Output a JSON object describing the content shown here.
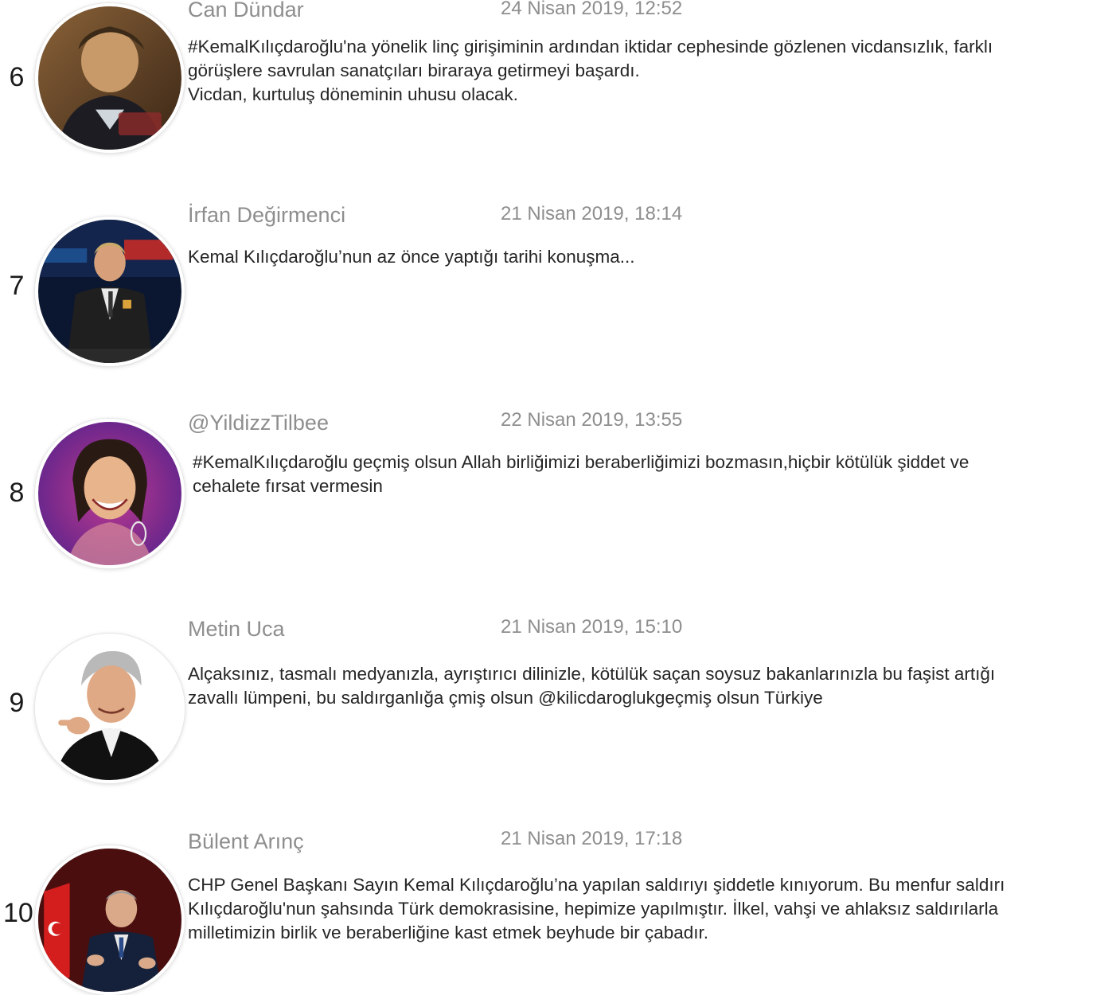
{
  "entries": [
    {
      "rank": "6",
      "name": "Can Dündar",
      "date": "24 Nisan 2019, 12:52",
      "avatar_icon": "person-photo-icon",
      "avatar_colors": [
        "#6b4a2a",
        "#1c1c22",
        "#d9b48a"
      ],
      "lines": [
        "#KemalKılıçdaroğlu'na yönelik linç girişiminin ardından iktidar cephesinde gözlenen vicdansızlık, farklı",
        "görüşlere savrulan sanatçıları biraraya getirmeyi başardı.",
        "Vicdan, kurtuluş döneminin uhusu olacak."
      ]
    },
    {
      "rank": "7",
      "name": "İrfan Değirmenci",
      "date": "21 Nisan 2019, 18:14",
      "avatar_icon": "person-photo-icon",
      "avatar_colors": [
        "#0b1730",
        "#1f1f1f",
        "#b22a2a"
      ],
      "lines": [
        "Kemal Kılıçdaroğlu’nun az önce yaptığı tarihi konuşma..."
      ]
    },
    {
      "rank": "8",
      "name": "@YildizzTilbee",
      "date": "22 Nisan 2019, 13:55",
      "avatar_icon": "person-photo-icon",
      "avatar_colors": [
        "#6a2fb0",
        "#c03a8f",
        "#e8b48c"
      ],
      "lines": [
        " #KemalKılıçdaroğlu geçmiş olsun  Allah birliğimizi beraberliğimizi bozmasın,hiçbir kötülük şiddet ve",
        " cehalete fırsat vermesin"
      ]
    },
    {
      "rank": "9",
      "name": "Metin Uca",
      "date": "21 Nisan 2019, 15:10",
      "avatar_icon": "person-photo-icon",
      "avatar_colors": [
        "#ffffff",
        "#111111",
        "#e0a985"
      ],
      "lines": [
        "Alçaksınız, tasmalı medyanızla, ayrıştırıcı dilinizle, kötülük saçan  soysuz bakanlarınızla bu faşist artığı",
        "zavallı lümpeni, bu saldırganlığa çmiş olsun @kilicdaroglukgeçmiş olsun Türkiye"
      ]
    },
    {
      "rank": "10",
      "name": "Bülent Arınç",
      "date": "21 Nisan 2019, 17:18",
      "avatar_icon": "person-photo-icon",
      "avatar_colors": [
        "#5a1010",
        "#15213a",
        "#d9a98a"
      ],
      "lines": [
        "CHP Genel Başkanı Sayın Kemal Kılıçdaroğlu’na yapılan saldırıyı şiddetle kınıyorum. Bu menfur saldırı",
        "Kılıçdaroğlu'nun şahsında Türk demokrasisine, hepimize yapılmıştır. İlkel, vahşi ve ahlaksız saldırılarla",
        "milletimizin birlik ve beraberliğine kast etmek beyhude bir çabadır."
      ]
    }
  ]
}
